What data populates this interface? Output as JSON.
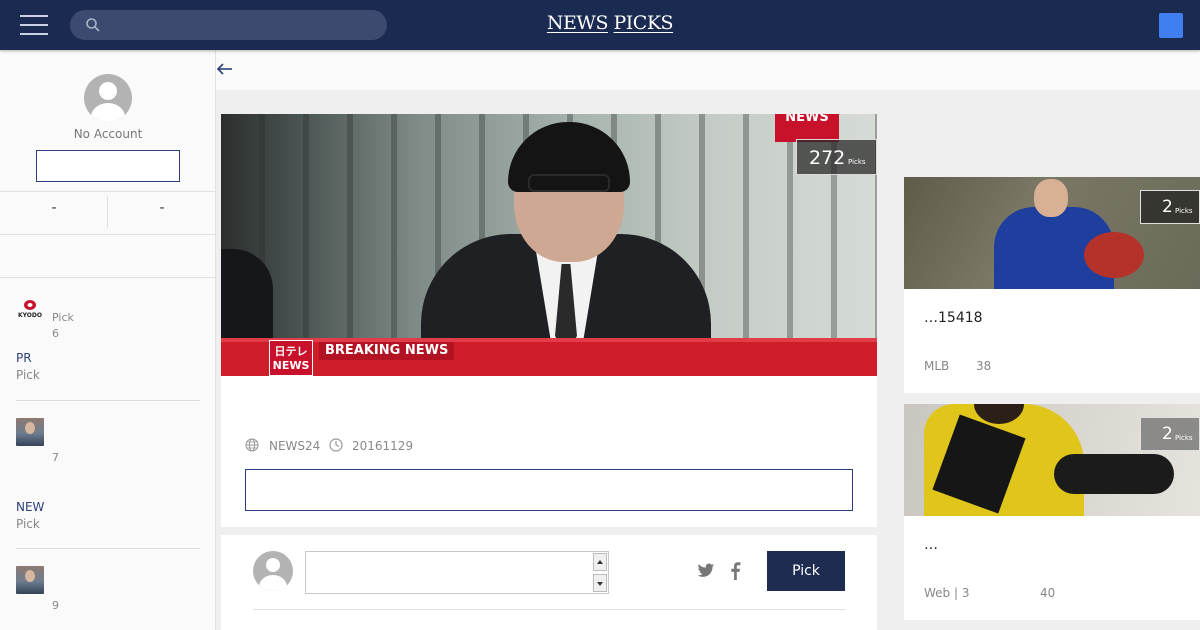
{
  "header": {
    "brand_left": "NEWS",
    "brand_right": "PICKS",
    "search_placeholder": ""
  },
  "sidebar": {
    "account_label": "No Account",
    "login_button_label": "",
    "stats": [
      "-",
      "-"
    ],
    "feed": [
      {
        "source_logo": "KYODO",
        "pick_label": "Pick",
        "count": "6",
        "category": "PR",
        "sub": "Pick"
      },
      {
        "count": "7",
        "category": "NEW",
        "sub": "Pick"
      },
      {
        "count": "9"
      }
    ]
  },
  "article": {
    "picks_count": "272",
    "picks_label": "Picks",
    "image_text": {
      "news_tag": "NEWS",
      "channel": "日テレ NEWS",
      "breaking": "BREAKING NEWS"
    },
    "source": "NEWS24",
    "date": "20161129",
    "read_button_label": ""
  },
  "comment": {
    "placeholder": "",
    "pick_button_label": "Pick"
  },
  "related": [
    {
      "picks_count": "2",
      "picks_label": "Picks",
      "title": "…15418",
      "source": "MLB",
      "count": "38"
    },
    {
      "picks_count": "2",
      "picks_label": "Picks",
      "title": "…",
      "source": "Web | 3",
      "count": "40"
    }
  ],
  "colors": {
    "header_bg": "#1b2a50",
    "accent": "#1e2c52",
    "user_button": "#3f7ff0",
    "breaking_red": "#d01d2a"
  }
}
